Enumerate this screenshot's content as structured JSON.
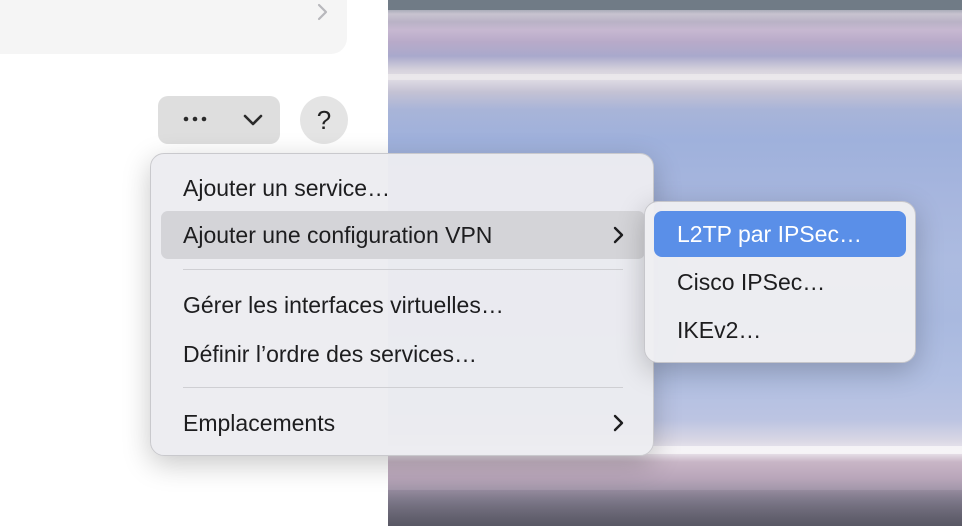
{
  "toolbar": {
    "more_icon": "ellipsis-icon",
    "dropdown_icon": "chevron-down-icon",
    "help_label": "?"
  },
  "menu": {
    "items": [
      {
        "label": "Ajouter un service…",
        "has_submenu": false,
        "highlighted": false
      },
      {
        "label": "Ajouter une configuration VPN",
        "has_submenu": true,
        "highlighted": true
      },
      {
        "label": "Gérer les interfaces virtuelles…",
        "has_submenu": false,
        "highlighted": false
      },
      {
        "label": "Définir l’ordre des services…",
        "has_submenu": false,
        "highlighted": false
      },
      {
        "label": "Emplacements",
        "has_submenu": true,
        "highlighted": false
      }
    ]
  },
  "submenu": {
    "items": [
      {
        "label": "L2TP par IPSec…",
        "active": true
      },
      {
        "label": "Cisco IPSec…",
        "active": false
      },
      {
        "label": "IKEv2…",
        "active": false
      }
    ]
  },
  "colors": {
    "highlight": "#d4d4d8",
    "selection": "#5a8fe8"
  }
}
